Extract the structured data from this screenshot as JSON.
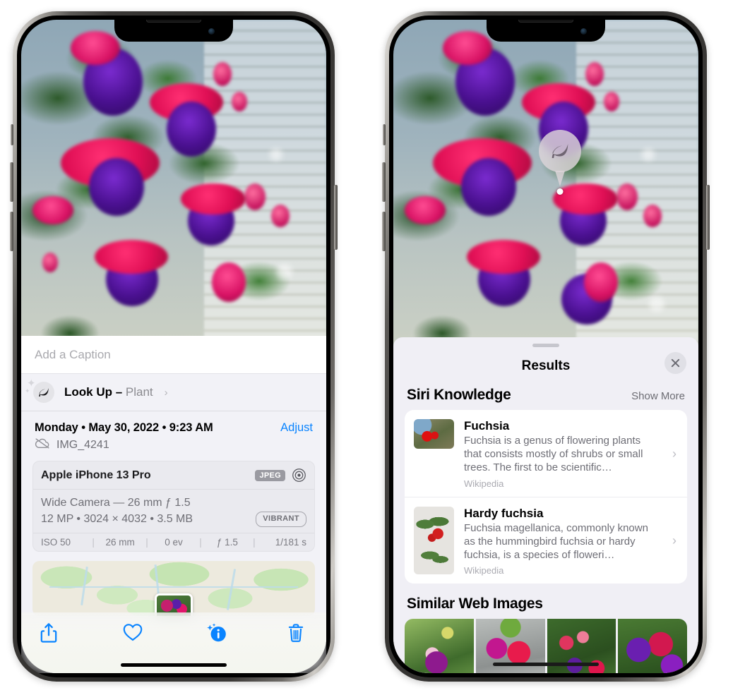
{
  "left_phone": {
    "caption": {
      "placeholder": "Add a Caption",
      "value": ""
    },
    "lookup": {
      "label": "Look Up – ",
      "subject": "Plant",
      "chevron": "›",
      "icon": "leaf-icon"
    },
    "date_row": {
      "date": "Monday • May 30, 2022 • 9:23 AM",
      "adjust_label": "Adjust"
    },
    "file_row": {
      "filename": "IMG_4241",
      "icon": "cloud-slash-icon"
    },
    "exif": {
      "device": "Apple iPhone 13 Pro",
      "format_badge": "JPEG",
      "aperture_icon": "aperture-icon",
      "lens_line": "Wide Camera — 26 mm ƒ 1.5",
      "size_line": "12 MP • 3024 × 4032 • 3.5 MB",
      "quality_badge": "VIBRANT",
      "stats": [
        "ISO 50",
        "26 mm",
        "0 ev",
        "ƒ 1.5",
        "1/181 s"
      ],
      "separator": "|"
    },
    "toolbar": [
      {
        "name": "share-icon",
        "label": "Share"
      },
      {
        "name": "heart-icon",
        "label": "Favorite"
      },
      {
        "name": "info-sparkle-icon",
        "label": "Info"
      },
      {
        "name": "trash-icon",
        "label": "Delete"
      }
    ]
  },
  "right_phone": {
    "visual_lookup_pin": {
      "icon": "leaf-icon"
    },
    "sheet": {
      "title": "Results",
      "close_icon": "close-icon",
      "sections": [
        {
          "title": "Siri Knowledge",
          "action": "Show More",
          "items": [
            {
              "title": "Fuchsia",
              "desc": "Fuchsia is a genus of flowering plants that consists mostly of shrubs or small trees. The first to be scientific…",
              "source": "Wikipedia",
              "chevron": "›"
            },
            {
              "title": "Hardy fuchsia",
              "desc": "Fuchsia magellanica, commonly known as the hummingbird fuchsia or hardy fuchsia, is a species of floweri…",
              "source": "Wikipedia",
              "chevron": "›"
            }
          ]
        },
        {
          "title": "Similar Web Images",
          "action": "",
          "thumbnails": 4
        }
      ]
    }
  },
  "colors": {
    "accent_blue": "#0a84ff",
    "sheet_bg": "#f0eff5",
    "info_bg": "#f2f2f7",
    "card_bg": "#eaeaef",
    "secondary_text": "#6e6e76",
    "tertiary_text": "#aaaab1"
  }
}
